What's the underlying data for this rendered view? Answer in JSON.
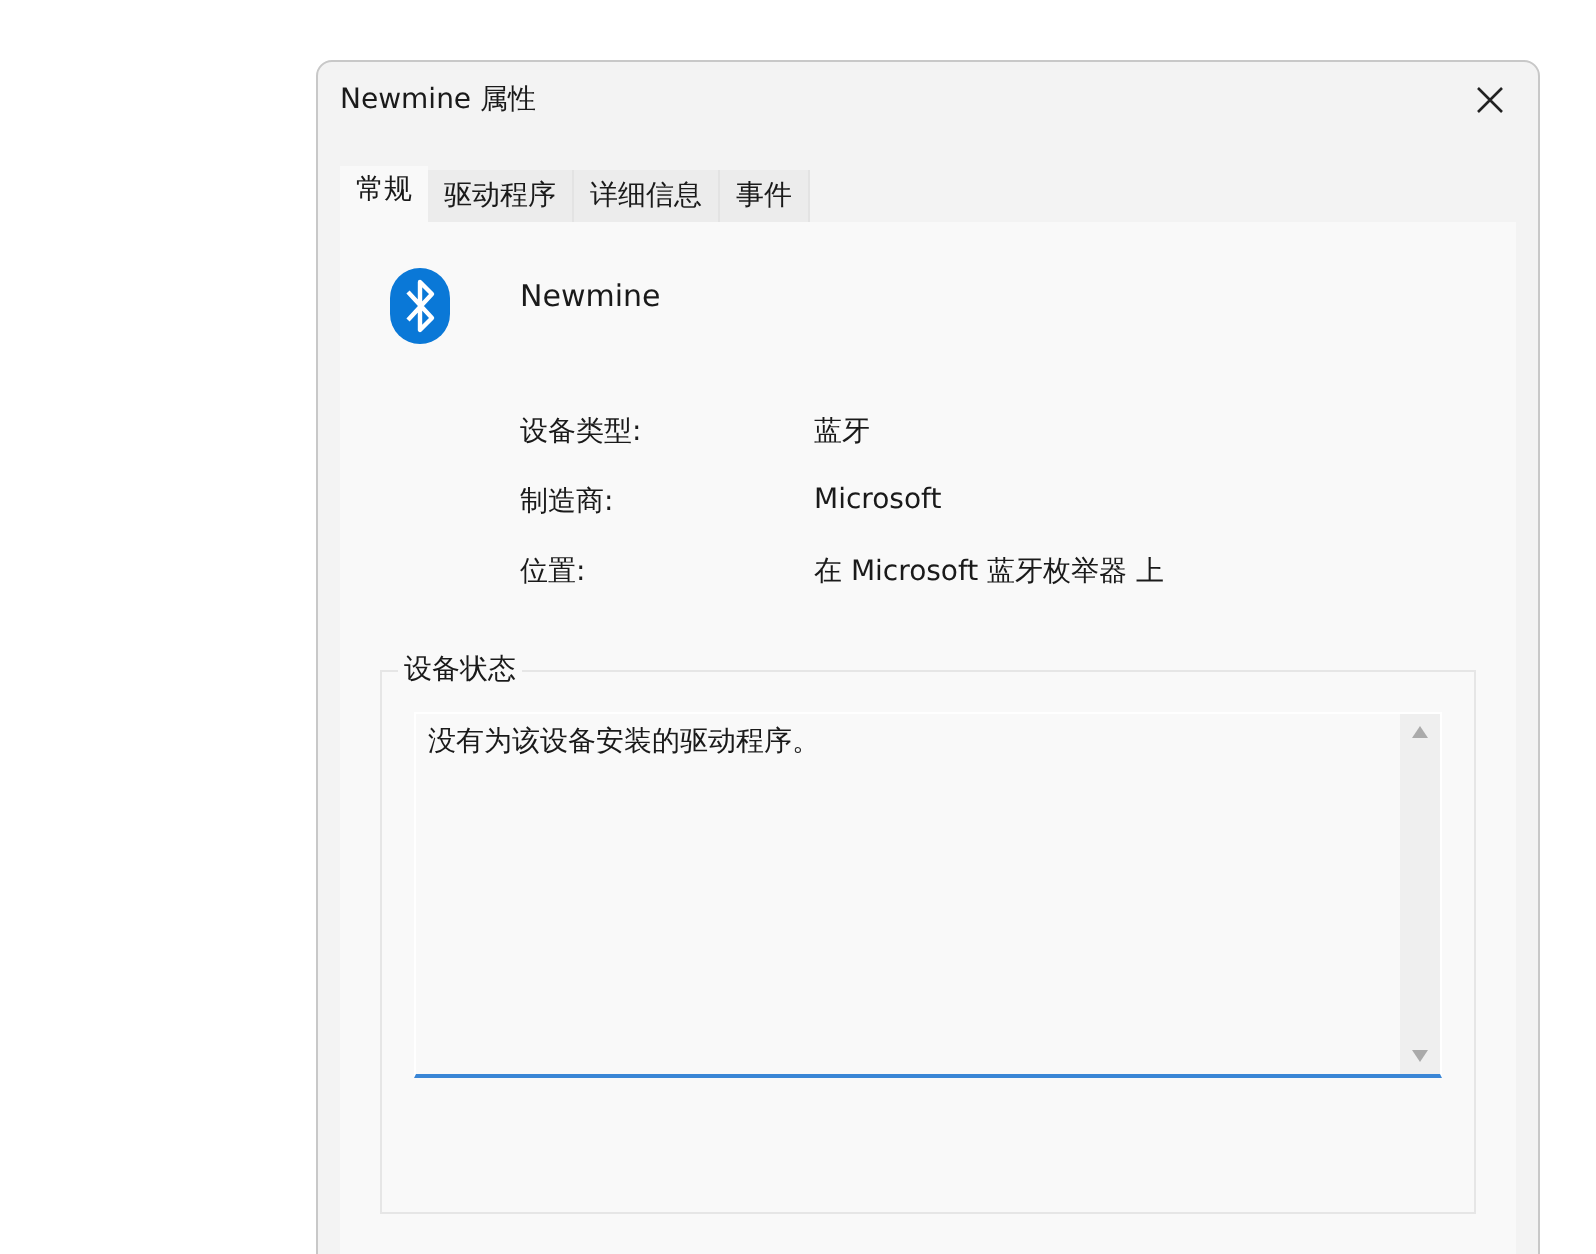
{
  "window": {
    "title": "Newmine 属性"
  },
  "tabs": [
    {
      "label": "常规",
      "selected": true
    },
    {
      "label": "驱动程序",
      "selected": false
    },
    {
      "label": "详细信息",
      "selected": false
    },
    {
      "label": "事件",
      "selected": false
    }
  ],
  "device": {
    "name": "Newmine"
  },
  "properties": [
    {
      "label": "设备类型:",
      "value": "蓝牙"
    },
    {
      "label": "制造商:",
      "value": "Microsoft"
    },
    {
      "label": "位置:",
      "value": "在 Microsoft 蓝牙枚举器 上"
    }
  ],
  "status_group": {
    "title": "设备状态",
    "text": "没有为该设备安装的驱动程序。"
  }
}
